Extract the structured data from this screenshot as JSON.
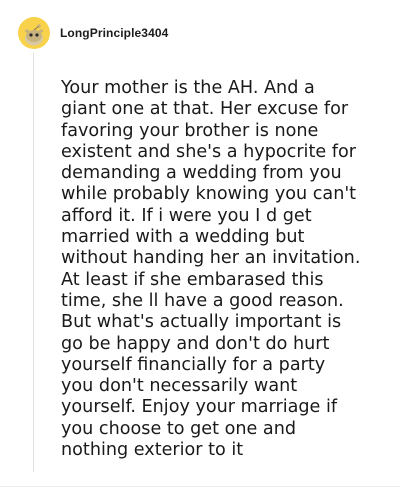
{
  "comment": {
    "username": "LongPrinciple3404",
    "avatar_icon": "reddit-snoo-avatar-icon",
    "avatar_color": "#f7d24a",
    "body": "Your mother is the AH.  And a\ngiant one at that. Her excuse for\nfavoring your brother is none\nexistent and she's a hypocrite for\ndemanding a wedding from you\nwhile probably knowing you can't\nafford it.  If i were you I d get\nmarried with a wedding but\nwithout handing her an invitation.\nAt least if she embarased this\ntime, she ll have a good reason.\nBut what's actually important is\ngo be happy and don't do hurt\nyourself financially for a party\nyou don't necessarily want\nyourself. Enjoy your marriage if\nyou choose to get one and\nnothing exterior to it"
  }
}
